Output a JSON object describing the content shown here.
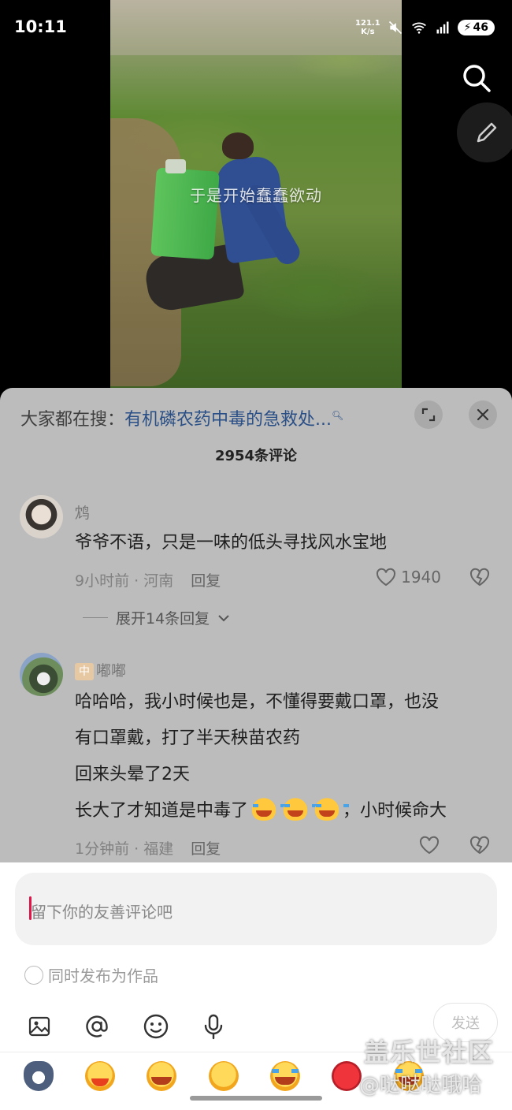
{
  "status_bar": {
    "time": "10:11",
    "net_speed_value": "121.1",
    "net_speed_unit": "K/s",
    "battery": "46"
  },
  "video": {
    "caption": "于是开始蠢蠢欲动"
  },
  "sheet": {
    "hot_search_prefix": "大家都在搜：",
    "hot_search_query": "有机磷农药中毒的急救处...",
    "comment_count": "2954条评论"
  },
  "comments": [
    {
      "username": "鸩",
      "text": "爷爷不语，只是一味的低头寻找风水宝地",
      "time_location": "9小时前 · 河南",
      "reply_label": "回复",
      "likes": "1940",
      "expand_label": "展开14条回复"
    },
    {
      "badge": "中",
      "username": "嘟嘟",
      "text_line1": "哈哈哈，我小时候也是，不懂得要戴口罩，也没",
      "text_line2": "有口罩戴，打了半天秧苗农药",
      "text_line3": "回来头晕了2天",
      "text_line4_a": "长大了才知道是中毒了",
      "text_line4_b": "，小时候命大",
      "time_location": "1分钟前 · 福建",
      "reply_label": "回复"
    }
  ],
  "input": {
    "placeholder": "留下你的友善评论吧",
    "also_post_label": "同时发布为作品",
    "send_label": "发送"
  },
  "icons": {
    "search": "search-icon",
    "edit": "pencil-icon",
    "expand": "expand-icon",
    "close": "close-icon",
    "heart": "heart-icon",
    "dislike": "broken-heart-icon",
    "image": "image-icon",
    "mention": "at-icon",
    "emoji": "smiley-icon",
    "voice": "microphone-icon"
  },
  "watermark": {
    "line1": "盖乐世社区",
    "line2": "@哒哒哒哦哈"
  }
}
